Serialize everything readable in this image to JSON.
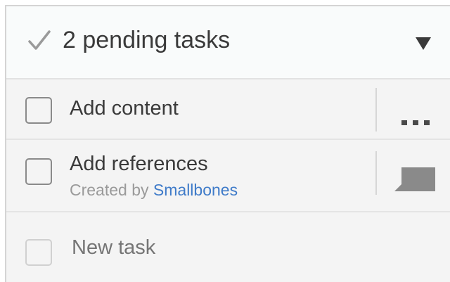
{
  "header": {
    "title": "2 pending tasks",
    "check_icon": "check-icon",
    "toggle_icon": "caret-down-icon"
  },
  "tasks": [
    {
      "label": "Add content",
      "action_icon": "more-icon"
    },
    {
      "label": "Add references",
      "created_by_prefix": "Created by",
      "created_by_user": "Smallbones",
      "action_icon": "comment-icon"
    }
  ],
  "new_task": {
    "placeholder": "New task"
  },
  "colors": {
    "link": "#3f7bc9",
    "check": "#9a9a9a",
    "text": "#3a3a3a"
  }
}
